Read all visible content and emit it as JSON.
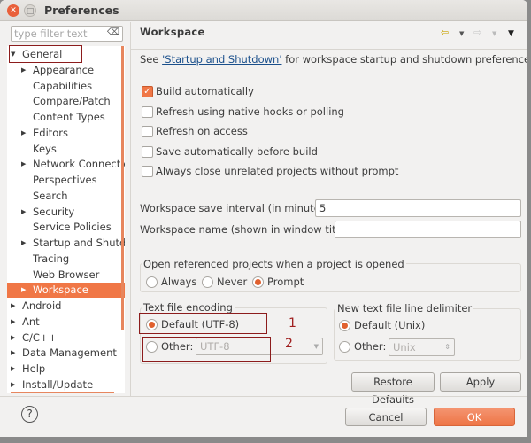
{
  "window": {
    "title": "Preferences"
  },
  "filter": {
    "placeholder": "type filter text"
  },
  "tree": [
    {
      "label": "General",
      "level": 0,
      "twisty": "open"
    },
    {
      "label": "Appearance",
      "level": 1,
      "twisty": "closed"
    },
    {
      "label": "Capabilities",
      "level": 1,
      "twisty": ""
    },
    {
      "label": "Compare/Patch",
      "level": 1,
      "twisty": ""
    },
    {
      "label": "Content Types",
      "level": 1,
      "twisty": ""
    },
    {
      "label": "Editors",
      "level": 1,
      "twisty": "closed"
    },
    {
      "label": "Keys",
      "level": 1,
      "twisty": ""
    },
    {
      "label": "Network Connections",
      "level": 1,
      "twisty": "closed"
    },
    {
      "label": "Perspectives",
      "level": 1,
      "twisty": ""
    },
    {
      "label": "Search",
      "level": 1,
      "twisty": ""
    },
    {
      "label": "Security",
      "level": 1,
      "twisty": "closed"
    },
    {
      "label": "Service Policies",
      "level": 1,
      "twisty": ""
    },
    {
      "label": "Startup and Shutdown",
      "level": 1,
      "twisty": "closed"
    },
    {
      "label": "Tracing",
      "level": 1,
      "twisty": ""
    },
    {
      "label": "Web Browser",
      "level": 1,
      "twisty": ""
    },
    {
      "label": "Workspace",
      "level": 1,
      "twisty": "closed",
      "selected": true
    },
    {
      "label": "Android",
      "level": 0,
      "twisty": "closed"
    },
    {
      "label": "Ant",
      "level": 0,
      "twisty": "closed"
    },
    {
      "label": "C/C++",
      "level": 0,
      "twisty": "closed"
    },
    {
      "label": "Data Management",
      "level": 0,
      "twisty": "closed"
    },
    {
      "label": "Help",
      "level": 0,
      "twisty": "closed"
    },
    {
      "label": "Install/Update",
      "level": 0,
      "twisty": "closed"
    }
  ],
  "page": {
    "title": "Workspace",
    "see_prefix": "See ",
    "see_link": "'Startup and Shutdown'",
    "see_suffix": " for workspace startup and shutdown preferences.",
    "checkboxes": [
      {
        "label": "Build automatically",
        "checked": true
      },
      {
        "label": "Refresh using native hooks or polling",
        "checked": false
      },
      {
        "label": "Refresh on access",
        "checked": false
      },
      {
        "label": "Save automatically before build",
        "checked": false
      },
      {
        "label": "Always close unrelated projects without prompt",
        "checked": false
      }
    ],
    "save_interval_label": "Workspace save interval (in minutes):",
    "save_interval_value": "5",
    "ws_name_label": "Workspace name (shown in window title):",
    "ws_name_value": "",
    "open_ref": {
      "label": "Open referenced projects when a project is opened",
      "options": [
        "Always",
        "Never",
        "Prompt"
      ],
      "selected": "Prompt"
    },
    "encoding": {
      "label": "Text file encoding",
      "default_label": "Default (UTF-8)",
      "other_label": "Other:",
      "other_value": "UTF-8",
      "selected": "default"
    },
    "delimiter": {
      "label": "New text file line delimiter",
      "default_label": "Default (Unix)",
      "other_label": "Other:",
      "other_value": "Unix",
      "selected": "default"
    },
    "restore_label": "Restore Defaults",
    "apply_label": "Apply"
  },
  "footer": {
    "cancel_label": "Cancel",
    "ok_label": "OK"
  },
  "annotations": {
    "n1": "1",
    "n2": "2"
  },
  "colors": {
    "accent": "#f07746",
    "annotation": "#8c1c1c"
  }
}
